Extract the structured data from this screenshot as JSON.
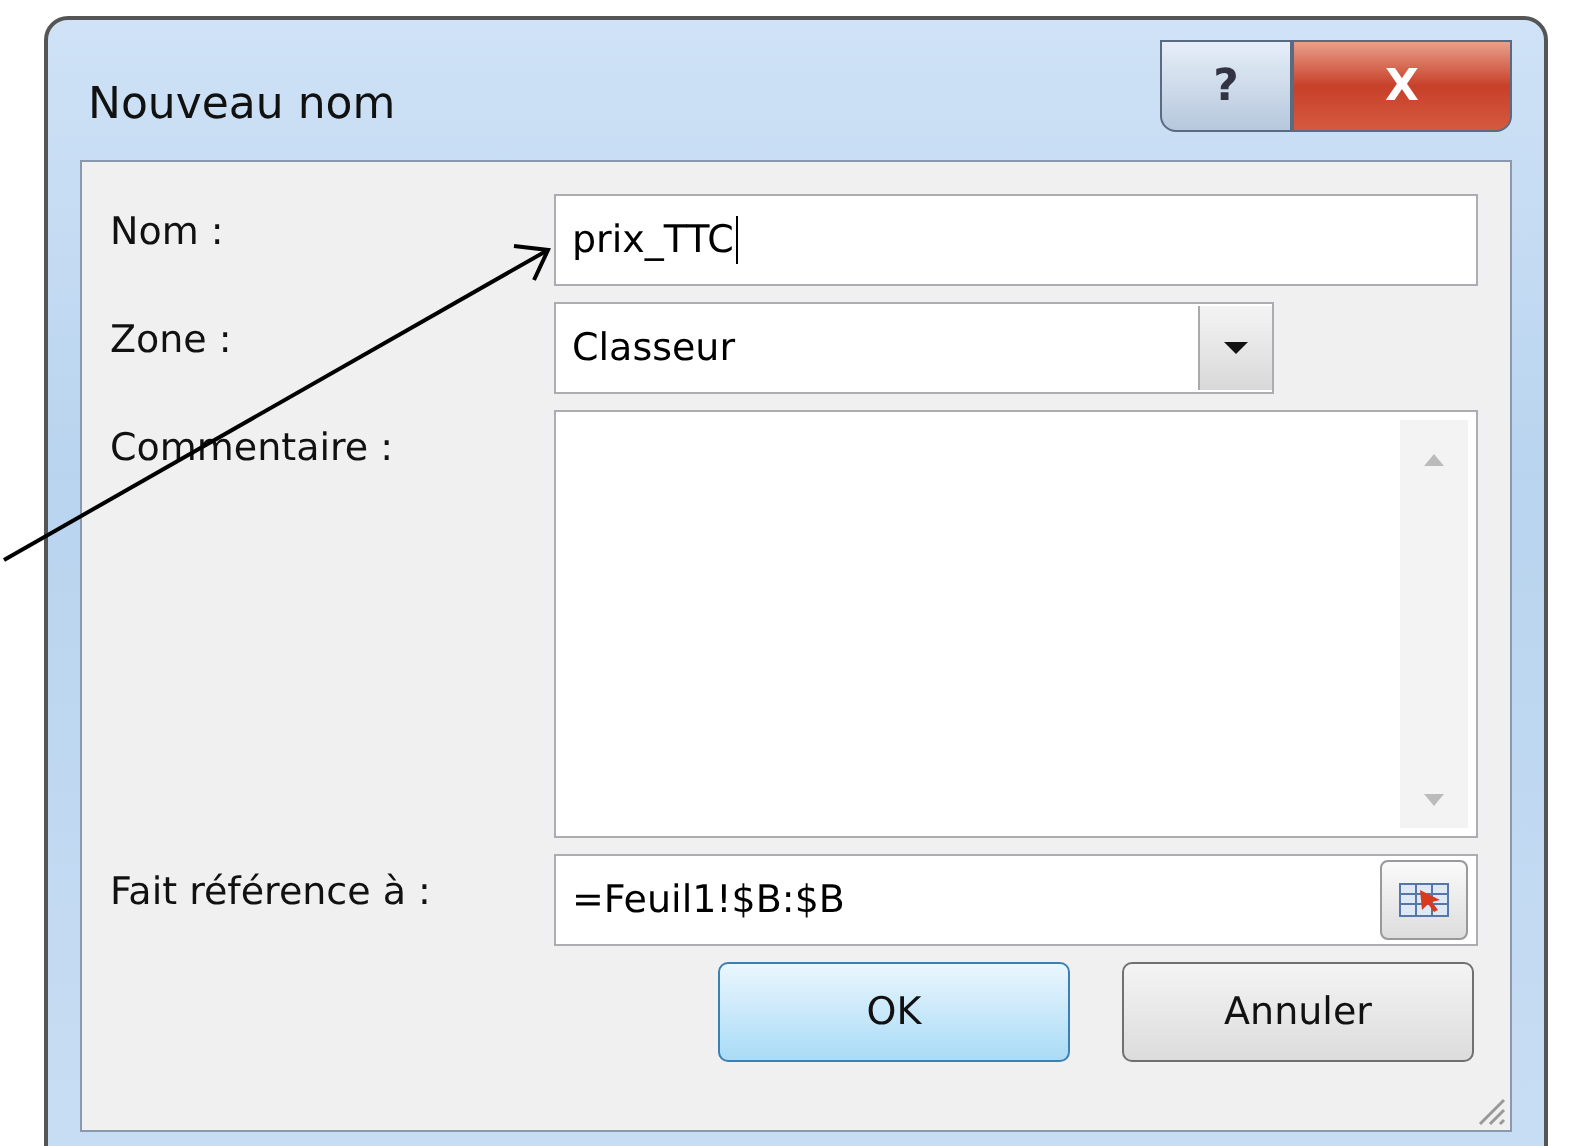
{
  "window": {
    "title": "Nouveau nom",
    "buttons": [
      {
        "kind": "help",
        "label": "?"
      },
      {
        "kind": "close",
        "label": "X"
      }
    ]
  },
  "fields": [
    {
      "kind": "text",
      "label": "Nom :",
      "value": "prix_TTC"
    },
    {
      "kind": "dropdown",
      "label": "Zone :",
      "value": "Classeur"
    },
    {
      "kind": "textarea",
      "label": "Commentaire :"
    },
    {
      "kind": "reference",
      "label": "Fait référence à :",
      "value": "=Feuil1!$B:$B"
    }
  ],
  "buttons": [
    {
      "label": "OK",
      "default": true
    },
    {
      "label": "Annuler",
      "default": false
    }
  ]
}
